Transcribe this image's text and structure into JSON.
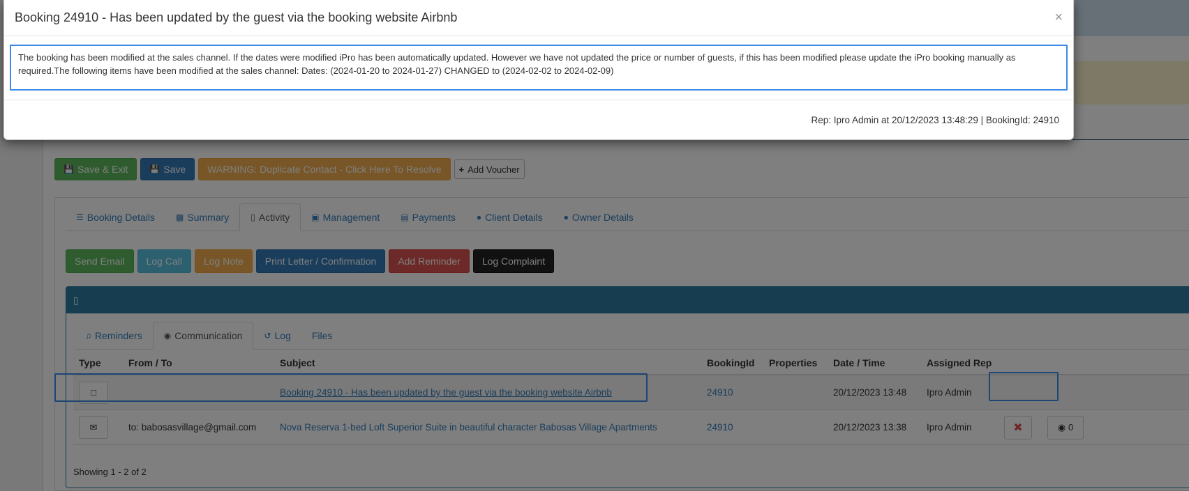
{
  "modal": {
    "title": "Booking 24910 - Has been updated by the guest via the booking website Airbnb",
    "close_glyph": "×",
    "message": "The booking has been modified at the sales channel. If the dates were modified iPro has been automatically updated. However we have not updated the price or number of guests, if this has been modified please update the iPro booking manually as required.The following items have been modified at the sales channel: Dates: (2024-01-20 to 2024-01-27) CHANGED to (2024-02-02 to 2024-02-09)",
    "footer": "Rep: Ipro Admin at 20/12/2023 13:48:29 | BookingId: 24910"
  },
  "toolbar": {
    "save_exit_label": "Save & Exit",
    "save_label": "Save",
    "warning_label": "WARNING: Duplicate Contact - Click Here To Resolve",
    "add_voucher_label": "Add Voucher"
  },
  "tabs": [
    {
      "label": "Booking Details",
      "icon": "list-icon"
    },
    {
      "label": "Summary",
      "icon": "money-icon"
    },
    {
      "label": "Activity",
      "icon": "inbox-icon",
      "active": true
    },
    {
      "label": "Management",
      "icon": "desktop-icon"
    },
    {
      "label": "Payments",
      "icon": "credit-card-icon"
    },
    {
      "label": "Client Details",
      "icon": "user-icon"
    },
    {
      "label": "Owner Details",
      "icon": "users-icon"
    }
  ],
  "activity_buttons": {
    "send_email": "Send Email",
    "log_call": "Log Call",
    "log_note": "Log Note",
    "print_letter": "Print Letter / Confirmation",
    "add_reminder": "Add Reminder",
    "log_complaint": "Log Complaint"
  },
  "comm_panel": {
    "header_icon": "inbox-icon",
    "subtabs": [
      {
        "label": "Reminders",
        "icon": "bell-icon"
      },
      {
        "label": "Communication",
        "icon": "comments-icon",
        "active": true
      },
      {
        "label": "Log",
        "icon": "history-icon"
      },
      {
        "label": "Files",
        "icon": ""
      }
    ],
    "columns": {
      "type": "Type",
      "from_to": "From / To",
      "subject": "Subject",
      "booking_id": "BookingId",
      "properties": "Properties",
      "date_time": "Date / Time",
      "assigned_rep": "Assigned Rep"
    },
    "rows": [
      {
        "type_icon": "note-icon",
        "from_to": "",
        "subject": "Booking 24910 - Has been updated by the guest via the booking website Airbnb",
        "booking_id": "24910",
        "properties": "",
        "date_time": "20/12/2023 13:48",
        "assigned_rep": "Ipro Admin"
      },
      {
        "type_icon": "envelope-icon",
        "from_to": "to: babosasvillage@gmail.com",
        "subject": "Nova Reserva 1-bed Loft Superior Suite in beautiful character Babosas Village Apartments",
        "booking_id": "24910",
        "properties": "",
        "date_time": "20/12/2023 13:38",
        "assigned_rep": "Ipro Admin",
        "view_count": "0"
      }
    ],
    "showing": "Showing 1 - 2 of 2"
  },
  "colors": {
    "highlight": "#3c8be6",
    "panel_header": "#2c7da0",
    "link": "#337ab7"
  }
}
